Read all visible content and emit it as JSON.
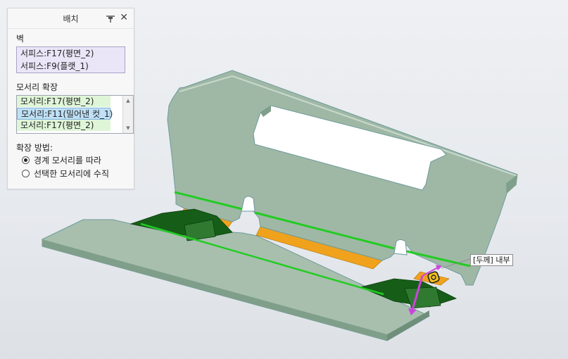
{
  "panel": {
    "title": "배치",
    "wall_label": "벽",
    "wall_refs": [
      "서피스:F17(평면_2)",
      "서피스:F9(플랫_1)"
    ],
    "edge_extend_label": "모서리 확장",
    "edge_refs": [
      "모서리:F17(평면_2)",
      "모서리:F11(밀어낸 컷_1)",
      "모서리:F17(평면_2)"
    ],
    "extend_method_label": "확장 방법:",
    "options": [
      "경계 모서리를 따라",
      "선택한 모서리에 수직"
    ],
    "selected_option_index": 0,
    "close_glyph": "✕"
  },
  "callout": {
    "label": "[두께] 내부"
  },
  "colors": {
    "sheet_fill": "#9fb8a5",
    "sheet_edge": "#6e9a9a",
    "flange_green": "#0f5a12",
    "orange": "#f0a21c",
    "green_line": "#22cc22",
    "magenta": "#cc44dd",
    "panel_bg": "#f7f7f8",
    "ref_bg": "#eae6f8",
    "list_selected": "#bfe0f6",
    "list_green": "#dff5d8"
  },
  "icons": [
    "pin-icon",
    "close-icon",
    "scroll-up-icon",
    "scroll-down-icon"
  ]
}
